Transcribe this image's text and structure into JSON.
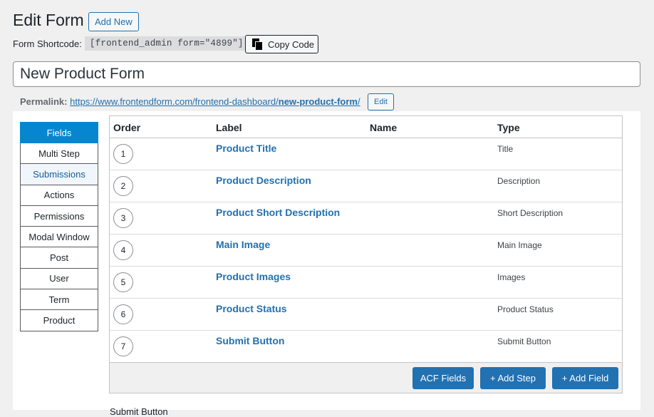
{
  "header": {
    "title": "Edit Form",
    "add_new_label": "Add New"
  },
  "shortcode": {
    "label": "Form Shortcode:",
    "value": "[frontend_admin form=\"4899\"]",
    "copy_label": "Copy Code",
    "copy_icon": "copy-icon"
  },
  "form_title": {
    "value": "New Product Form"
  },
  "permalink": {
    "label": "Permalink:",
    "base_url": "https://www.frontendform.com/frontend-dashboard/",
    "slug": "new-product-form",
    "trailing": "/",
    "edit_label": "Edit"
  },
  "tabs": [
    {
      "label": "Fields"
    },
    {
      "label": "Multi Step"
    },
    {
      "label": "Submissions"
    },
    {
      "label": "Actions"
    },
    {
      "label": "Permissions"
    },
    {
      "label": "Modal Window"
    },
    {
      "label": "Post"
    },
    {
      "label": "User"
    },
    {
      "label": "Term"
    },
    {
      "label": "Product"
    }
  ],
  "table": {
    "columns": [
      "Order",
      "Label",
      "Name",
      "Type"
    ],
    "rows": [
      {
        "order": "1",
        "label": "Product Title",
        "name": "",
        "type": "Title"
      },
      {
        "order": "2",
        "label": "Product Description",
        "name": "",
        "type": "Description"
      },
      {
        "order": "3",
        "label": "Product Short Description",
        "name": "",
        "type": "Short Description"
      },
      {
        "order": "4",
        "label": "Main Image",
        "name": "",
        "type": "Main Image"
      },
      {
        "order": "5",
        "label": "Product Images",
        "name": "",
        "type": "Images"
      },
      {
        "order": "6",
        "label": "Product Status",
        "name": "",
        "type": "Product Status"
      },
      {
        "order": "7",
        "label": "Submit Button",
        "name": "",
        "type": "Submit Button"
      }
    ],
    "footer": {
      "acf_label": "ACF Fields",
      "add_step_label": "+ Add Step",
      "add_field_label": "+ Add Field"
    }
  },
  "below_table": {
    "peek_text": "Submit Button"
  },
  "colors": {
    "accent": "#2271b1",
    "active_tab": "#0786d0",
    "background": "#f0f0f1"
  }
}
